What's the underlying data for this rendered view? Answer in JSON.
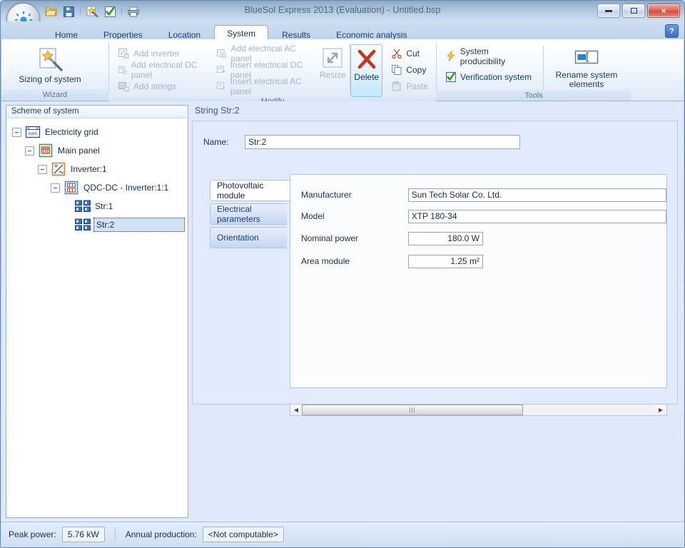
{
  "window": {
    "title": "BlueSol Express 2013 (Evaluation) - Untitled.bsp",
    "logo_icon": "sun-logo-icon",
    "minimize_label": "minimize-icon",
    "maximize_label": "maximize-icon",
    "close_label": "×"
  },
  "quick_access": [
    {
      "name": "open-icon",
      "glyph": "open-folder"
    },
    {
      "name": "save-icon",
      "glyph": "floppy-disk"
    },
    {
      "name": "wizard-icon",
      "glyph": "page-star"
    },
    {
      "name": "verify-icon",
      "glyph": "green-check"
    },
    {
      "name": "print-icon",
      "glyph": "printer"
    }
  ],
  "tabs": [
    {
      "label": "Home",
      "active": false
    },
    {
      "label": "Properties",
      "active": false
    },
    {
      "label": "Location",
      "active": false
    },
    {
      "label": "System",
      "active": true
    },
    {
      "label": "Results",
      "active": false
    },
    {
      "label": "Economic analysis",
      "active": false
    }
  ],
  "help_button": "?",
  "ribbon": {
    "groups": [
      {
        "title": "Wizard"
      },
      {
        "title": "Modify"
      },
      {
        "title": "Tools"
      }
    ],
    "wizard": {
      "sizing_label": "Sizing of system",
      "sizing_icon": "wand-page-icon"
    },
    "modify": {
      "col1": [
        {
          "label": "Add inverter",
          "icon": "inverter-add-icon",
          "disabled": true
        },
        {
          "label": "Add electrical DC panel",
          "icon": "dc-panel-add-icon",
          "disabled": true
        },
        {
          "label": "Add strings",
          "icon": "strings-add-icon",
          "disabled": true
        }
      ],
      "col2": [
        {
          "label": "Add electrical AC panel",
          "icon": "ac-panel-add-icon",
          "disabled": true
        },
        {
          "label": "Insert electrical DC panel",
          "icon": "dc-panel-insert-icon",
          "disabled": true
        },
        {
          "label": "Insert electrical AC panel",
          "icon": "ac-panel-insert-icon",
          "disabled": true
        }
      ],
      "resize_label": "Resize",
      "resize_icon": "resize-arrows-icon",
      "delete_label": "Delete",
      "delete_icon": "red-x-icon",
      "clipboard": [
        {
          "label": "Cut",
          "icon": "scissors-icon",
          "disabled": false
        },
        {
          "label": "Copy",
          "icon": "copy-icon",
          "disabled": false
        },
        {
          "label": "Paste",
          "icon": "paste-icon",
          "disabled": true
        }
      ]
    },
    "tools": {
      "producibility_label": "System producibility",
      "producibility_icon": "lightning-bolt-icon",
      "verification_label": "Verification system",
      "verification_icon": "green-check-icon",
      "rename_label": "Rename system\nelements",
      "rename_label_line1": "Rename system",
      "rename_label_line2": "elements",
      "rename_icon": "rename-field-icon"
    }
  },
  "tree": {
    "header": "Scheme of system",
    "nodes": [
      {
        "label": "Electricity grid",
        "icon": "grid-meter-icon",
        "depth": 0,
        "expandable": true,
        "selected": false
      },
      {
        "label": "Main panel",
        "icon": "main-panel-icon",
        "depth": 1,
        "expandable": true,
        "selected": false
      },
      {
        "label": "Inverter:1",
        "icon": "inverter-icon",
        "depth": 2,
        "expandable": true,
        "selected": false
      },
      {
        "label": "QDC-DC - Inverter:1:1",
        "icon": "dc-panel-icon",
        "depth": 3,
        "expandable": true,
        "selected": false
      },
      {
        "label": "Str:1",
        "icon": "string-icon",
        "depth": 4,
        "expandable": false,
        "selected": false
      },
      {
        "label": "Str:2",
        "icon": "string-icon",
        "depth": 4,
        "expandable": false,
        "selected": true
      }
    ]
  },
  "detail": {
    "title": "String Str:2",
    "name_label": "Name:",
    "name_value": "Str:2",
    "vtabs": [
      {
        "label": "Photovoltaic module",
        "active": true
      },
      {
        "label": "Electrical parameters",
        "active": false
      },
      {
        "label": "Orientation",
        "active": false
      }
    ],
    "fields": [
      {
        "label": "Manufacturer",
        "value": "Sun Tech Solar Co. Ltd.",
        "type": "wide"
      },
      {
        "label": "Model",
        "value": "XTP 180-34",
        "type": "wide"
      },
      {
        "label": "Nominal power",
        "value": "180.0 W",
        "type": "num"
      },
      {
        "label": "Area module",
        "value": "1.25 m²",
        "type": "num"
      }
    ],
    "scroll_left_icon": "◀",
    "scroll_right_icon": "▶",
    "scroll_grip": "|||"
  },
  "statusbar": {
    "peak_power_label": "Peak power:",
    "peak_power_value": "5.76 kW",
    "annual_label": "Annual production:",
    "annual_value": "<Not computable>"
  },
  "colors": {
    "accent": "#3a6fbd",
    "content_bg": "#e1ebfd",
    "close_red": "#d3493d"
  }
}
